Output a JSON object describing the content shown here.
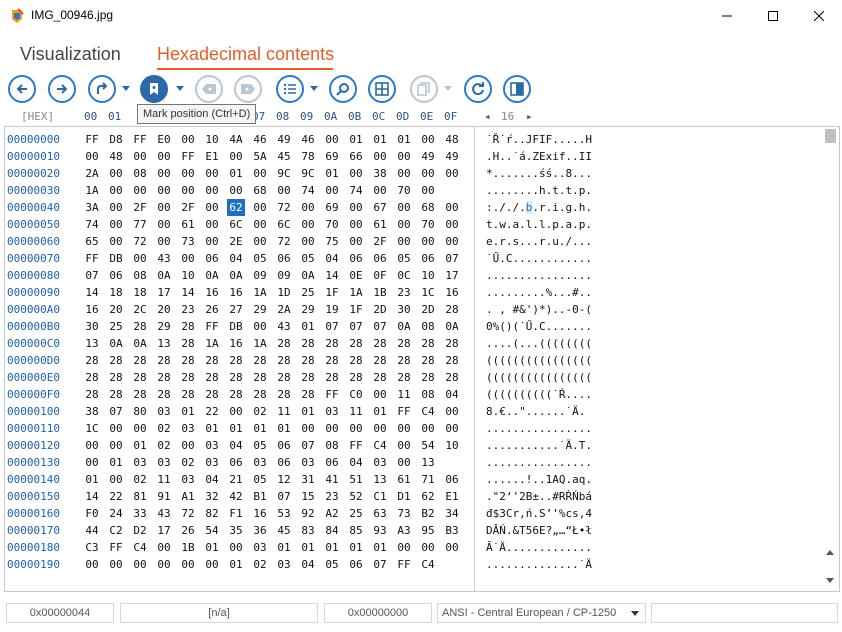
{
  "window": {
    "title": "IMG_00946.jpg",
    "minimize_icon": "minimize-icon",
    "maximize_icon": "maximize-icon",
    "close_icon": "close-icon"
  },
  "tabs": [
    {
      "label": "Visualization",
      "active": false
    },
    {
      "label": "Hexadecimal contents",
      "active": true
    }
  ],
  "toolbar": {
    "buttons": [
      "back-icon",
      "forward-icon",
      "redo-icon",
      "mark-position-icon",
      "prev-mark-icon",
      "next-mark-icon",
      "list-icon",
      "search-icon",
      "grid-icon",
      "copy-icon",
      "refresh-icon",
      "panel-icon"
    ],
    "tooltip": "Mark position (Ctrl+D)"
  },
  "hex_header": {
    "label": "[HEX]",
    "columns": [
      "00",
      "01",
      "02",
      "03",
      "04",
      "05",
      "06",
      "07",
      "08",
      "09",
      "0A",
      "0B",
      "0C",
      "0D",
      "0E",
      "0F"
    ],
    "bytes_per_row": "16"
  },
  "hex_view": {
    "addresses": [
      "00000000",
      "00000010",
      "00000020",
      "00000030",
      "00000040",
      "00000050",
      "00000060",
      "00000070",
      "00000080",
      "00000090",
      "000000A0",
      "000000B0",
      "000000C0",
      "000000D0",
      "000000E0",
      "000000F0",
      "00000100",
      "00000110",
      "00000120",
      "00000130",
      "00000140",
      "00000150",
      "00000160",
      "00000170",
      "00000180",
      "00000190"
    ],
    "rows": [
      [
        "FF",
        "D8",
        "FF",
        "E0",
        "00",
        "10",
        "4A",
        "46",
        "49",
        "46",
        "00",
        "01",
        "01",
        "01",
        "00",
        "48"
      ],
      [
        "00",
        "48",
        "00",
        "00",
        "FF",
        "E1",
        "00",
        "5A",
        "45",
        "78",
        "69",
        "66",
        "00",
        "00",
        "49",
        "49"
      ],
      [
        "2A",
        "00",
        "08",
        "00",
        "00",
        "00",
        "01",
        "00",
        "9C",
        "9C",
        "01",
        "00",
        "38",
        "00",
        "00",
        "00"
      ],
      [
        "1A",
        "00",
        "00",
        "00",
        "00",
        "00",
        "00",
        "68",
        "00",
        "74",
        "00",
        "74",
        "00",
        "70",
        "00",
        " "
      ],
      [
        "3A",
        "00",
        "2F",
        "00",
        "2F",
        "00",
        "62",
        "00",
        "72",
        "00",
        "69",
        "00",
        "67",
        "00",
        "68",
        "00"
      ],
      [
        "74",
        "00",
        "77",
        "00",
        "61",
        "00",
        "6C",
        "00",
        "6C",
        "00",
        "70",
        "00",
        "61",
        "00",
        "70",
        "00"
      ],
      [
        "65",
        "00",
        "72",
        "00",
        "73",
        "00",
        "2E",
        "00",
        "72",
        "00",
        "75",
        "00",
        "2F",
        "00",
        "00",
        "00"
      ],
      [
        "FF",
        "DB",
        "00",
        "43",
        "00",
        "06",
        "04",
        "05",
        "06",
        "05",
        "04",
        "06",
        "06",
        "05",
        "06",
        "07"
      ],
      [
        "07",
        "06",
        "08",
        "0A",
        "10",
        "0A",
        "0A",
        "09",
        "09",
        "0A",
        "14",
        "0E",
        "0F",
        "0C",
        "10",
        "17"
      ],
      [
        "14",
        "18",
        "18",
        "17",
        "14",
        "16",
        "16",
        "1A",
        "1D",
        "25",
        "1F",
        "1A",
        "1B",
        "23",
        "1C",
        "16"
      ],
      [
        "16",
        "20",
        "2C",
        "20",
        "23",
        "26",
        "27",
        "29",
        "2A",
        "29",
        "19",
        "1F",
        "2D",
        "30",
        "2D",
        "28"
      ],
      [
        "30",
        "25",
        "28",
        "29",
        "28",
        "FF",
        "DB",
        "00",
        "43",
        "01",
        "07",
        "07",
        "07",
        "0A",
        "08",
        "0A"
      ],
      [
        "13",
        "0A",
        "0A",
        "13",
        "28",
        "1A",
        "16",
        "1A",
        "28",
        "28",
        "28",
        "28",
        "28",
        "28",
        "28",
        "28"
      ],
      [
        "28",
        "28",
        "28",
        "28",
        "28",
        "28",
        "28",
        "28",
        "28",
        "28",
        "28",
        "28",
        "28",
        "28",
        "28",
        "28"
      ],
      [
        "28",
        "28",
        "28",
        "28",
        "28",
        "28",
        "28",
        "28",
        "28",
        "28",
        "28",
        "28",
        "28",
        "28",
        "28",
        "28"
      ],
      [
        "28",
        "28",
        "28",
        "28",
        "28",
        "28",
        "28",
        "28",
        "28",
        "28",
        "FF",
        "C0",
        "00",
        "11",
        "08",
        "04"
      ],
      [
        "38",
        "07",
        "80",
        "03",
        "01",
        "22",
        "00",
        "02",
        "11",
        "01",
        "03",
        "11",
        "01",
        "FF",
        "C4",
        "00"
      ],
      [
        "1C",
        "00",
        "00",
        "02",
        "03",
        "01",
        "01",
        "01",
        "01",
        "00",
        "00",
        "00",
        "00",
        "00",
        "00",
        "00"
      ],
      [
        "00",
        "00",
        "01",
        "02",
        "00",
        "03",
        "04",
        "05",
        "06",
        "07",
        "08",
        "FF",
        "C4",
        "00",
        "54",
        "10"
      ],
      [
        "00",
        "01",
        "03",
        "03",
        "02",
        "03",
        "06",
        "03",
        "06",
        "03",
        "06",
        "04",
        "03",
        "00",
        "13",
        " "
      ],
      [
        "01",
        "00",
        "02",
        "11",
        "03",
        "04",
        "21",
        "05",
        "12",
        "31",
        "41",
        "51",
        "13",
        "61",
        "71",
        "06"
      ],
      [
        "14",
        "22",
        "81",
        "91",
        "A1",
        "32",
        "42",
        "B1",
        "07",
        "15",
        "23",
        "52",
        "C1",
        "D1",
        "62",
        "E1"
      ],
      [
        "F0",
        "24",
        "33",
        "43",
        "72",
        "82",
        "F1",
        "16",
        "53",
        "92",
        "A2",
        "25",
        "63",
        "73",
        "B2",
        "34"
      ],
      [
        "44",
        "C2",
        "D2",
        "17",
        "26",
        "54",
        "35",
        "36",
        "45",
        "83",
        "84",
        "85",
        "93",
        "A3",
        "95",
        "B3"
      ],
      [
        "C3",
        "FF",
        "C4",
        "00",
        "1B",
        "01",
        "00",
        "03",
        "01",
        "01",
        "01",
        "01",
        "01",
        "00",
        "00",
        "00"
      ],
      [
        "00",
        "00",
        "00",
        "00",
        "00",
        "00",
        "01",
        "02",
        "03",
        "04",
        "05",
        "06",
        "07",
        "FF",
        "C4",
        " "
      ]
    ],
    "text": [
      "˙Ř˙ŕ..JFIF.....H",
      ".H..˙á.ZExif..II",
      "*.......śś..8...",
      "........h.t.t.p.",
      ":././.b.r.i.g.h.",
      "t.w.a.l.l.p.a.p.",
      "e.r.s...r.u./...",
      "˙Ű.C............",
      "................",
      ".........%...#..",
      ". , #&')*)..-0-(",
      "0%()(˙Ű.C.......",
      "....(...((((((((",
      "((((((((((((((((",
      "((((((((((((((((",
      "((((((((((˙Ŕ....",
      "8.€..\"......˙Ä.",
      "................",
      "...........˙Ä.T.",
      "................",
      "......!..1AQ.aq.",
      ".\"2‘'2B±..#RŔŃbá",
      "đ$3Cr,ń.S’'%cs,4",
      "DÂŃ.&T56E?„…“Ł•ł",
      "Ă˙Ä.............",
      "..............˙Ä"
    ],
    "highlight": {
      "row": 4,
      "col": 6
    }
  },
  "status": {
    "offset": "0x00000044",
    "selection": "[n/a]",
    "value": "0x00000000",
    "encoding": "ANSI - Central European / CP-1250",
    "extra": ""
  },
  "colors": {
    "accent": "#e35d2a",
    "toolbar_blue": "#2b7ac7",
    "address_blue": "#1f5fae",
    "highlight": "#1f6fc4"
  }
}
